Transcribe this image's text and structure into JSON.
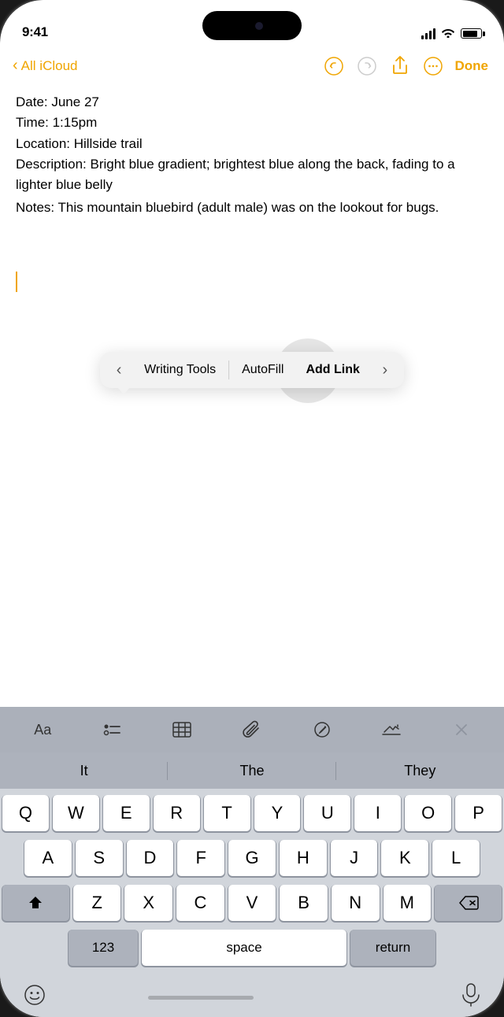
{
  "status": {
    "time": "9:41"
  },
  "nav": {
    "back_label": "All iCloud",
    "done_label": "Done"
  },
  "note": {
    "line1": "Date: June 27",
    "line2": "Time: 1:15pm",
    "line3": "Location: Hillside trail",
    "line4": "Description: Bright blue gradient; brightest blue along the back, fading to a lighter blue belly",
    "line5": "Notes: This mountain bluebird (adult male) was on the lookout for bugs."
  },
  "toolbar": {
    "prev_icon": "‹",
    "next_icon": "›",
    "writing_tools_label": "Writing Tools",
    "autofill_label": "AutoFill",
    "add_link_label": "Add Link"
  },
  "predictive": {
    "item1": "It",
    "item2": "The",
    "item3": "They"
  },
  "keyboard": {
    "row1": [
      "Q",
      "W",
      "E",
      "R",
      "T",
      "Y",
      "U",
      "I",
      "O",
      "P"
    ],
    "row2": [
      "A",
      "S",
      "D",
      "F",
      "G",
      "H",
      "J",
      "K",
      "L"
    ],
    "row3": [
      "Z",
      "X",
      "C",
      "V",
      "B",
      "N",
      "M"
    ],
    "space_label": "space",
    "num_label": "123",
    "return_label": "return"
  },
  "bottom": {
    "emoji_icon": "emoji",
    "mic_icon": "mic"
  },
  "colors": {
    "accent": "#f0a500"
  }
}
